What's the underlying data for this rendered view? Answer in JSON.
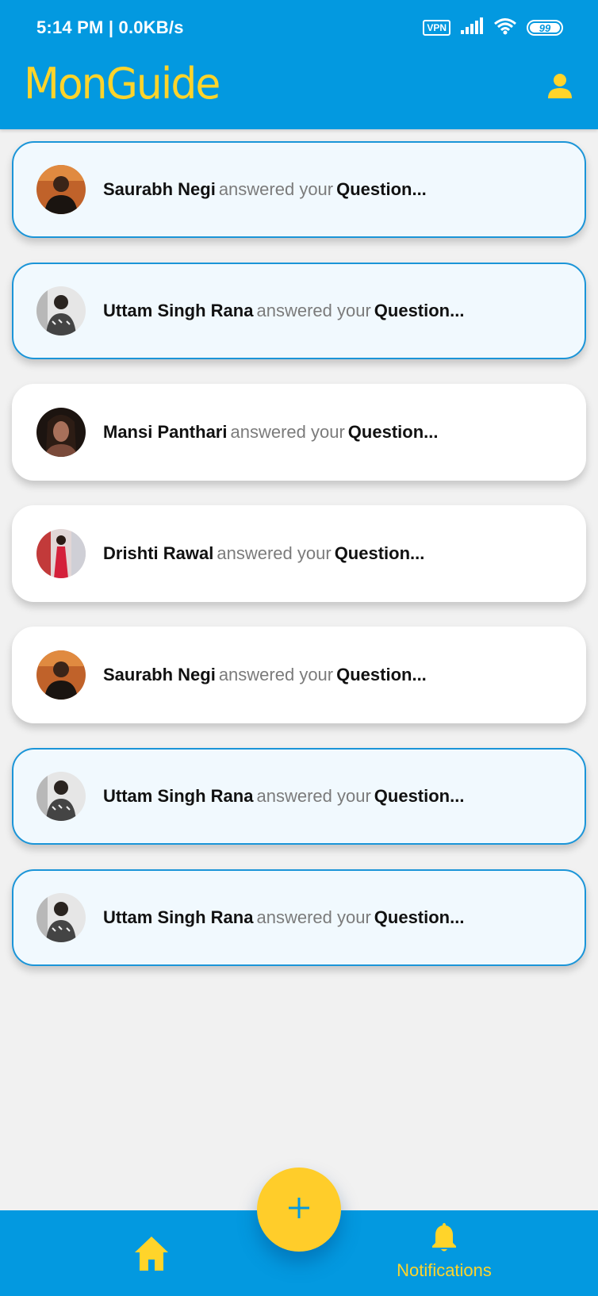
{
  "status_bar": {
    "time": "5:14 PM | 0.0KB/s",
    "vpn": "VPN",
    "battery": "99"
  },
  "header": {
    "title": "MonGuide",
    "profile_icon": "person-icon"
  },
  "notifications": [
    {
      "name": "Saurabh Negi",
      "action": "answered your",
      "object": "Question...",
      "state": "unread",
      "avatar": "saurabh"
    },
    {
      "name": "Uttam Singh Rana",
      "action": "answered your",
      "object": "Question...",
      "state": "unread",
      "avatar": "uttam"
    },
    {
      "name": "Mansi Panthari",
      "action": "answered your",
      "object": "Question...",
      "state": "read",
      "avatar": "mansi"
    },
    {
      "name": "Drishti Rawal",
      "action": "answered your",
      "object": "Question...",
      "state": "read",
      "avatar": "drishti"
    },
    {
      "name": "Saurabh Negi",
      "action": "answered your",
      "object": "Question...",
      "state": "read",
      "avatar": "saurabh"
    },
    {
      "name": "Uttam Singh Rana",
      "action": "answered your",
      "object": "Question...",
      "state": "unread",
      "avatar": "uttam"
    },
    {
      "name": "Uttam Singh Rana",
      "action": "answered your",
      "object": "Question...",
      "state": "unread",
      "avatar": "uttam"
    }
  ],
  "bottom_nav": {
    "home_icon": "home-icon",
    "notifications_label": "Notifications",
    "notifications_icon": "bell-icon",
    "fab_icon": "plus-icon"
  },
  "colors": {
    "primary": "#0399e0",
    "accent": "#ffd42a",
    "fab": "#ffcd2a",
    "unread_card_bg": "#f1f9fe",
    "unread_border": "#1b95d8"
  }
}
